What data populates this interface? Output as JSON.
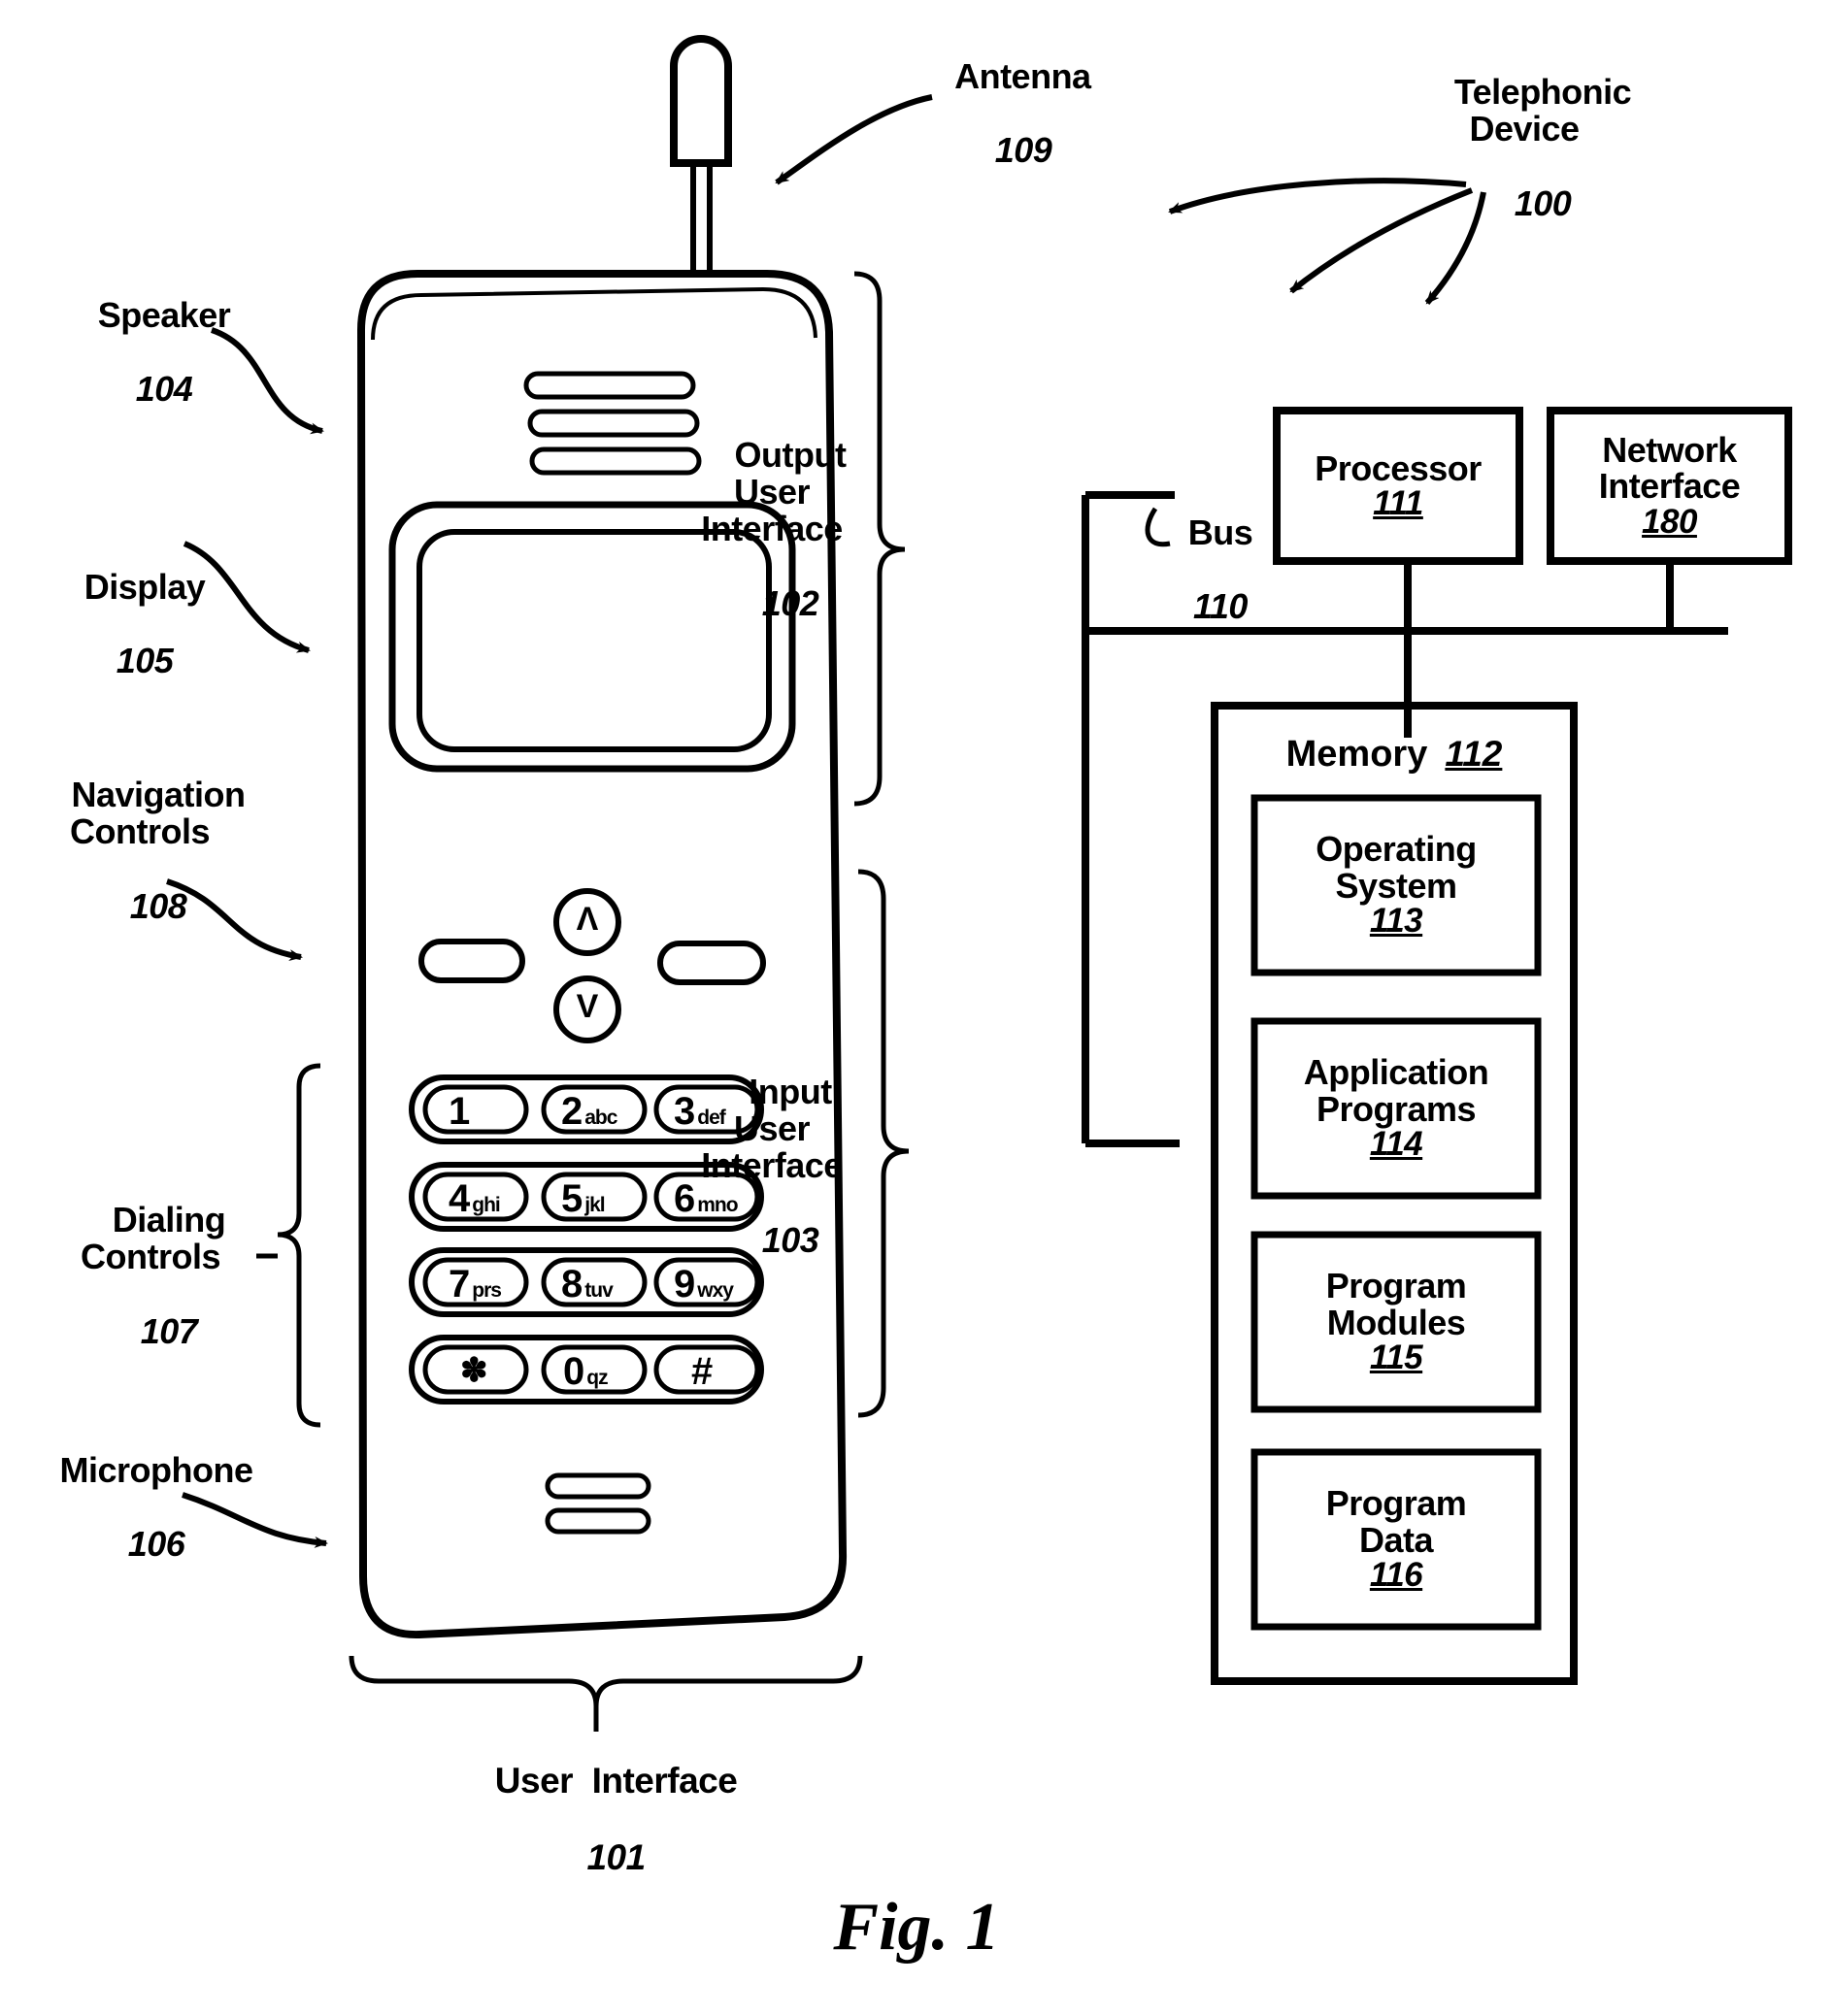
{
  "figure": {
    "caption": "Fig.   1"
  },
  "callouts": {
    "antenna": {
      "label": "Antenna",
      "ref": "109"
    },
    "telephonic_device": {
      "label": "Telephonic\nDevice",
      "ref": "100"
    },
    "speaker": {
      "label": "Speaker",
      "ref": "104"
    },
    "display": {
      "label": "Display",
      "ref": "105"
    },
    "navigation_controls": {
      "label": "Navigation\nControls",
      "ref": "108"
    },
    "dialing_controls": {
      "label": "Dialing\nControls",
      "ref": "107"
    },
    "microphone": {
      "label": "Microphone",
      "ref": "106"
    },
    "user_interface": {
      "label": "User  Interface",
      "ref": "101"
    },
    "output_user_interface": {
      "label": "Output\nUser\nInterface",
      "ref": "102"
    },
    "input_user_interface": {
      "label": "Input\nUser\nInterface",
      "ref": "103"
    },
    "bus": {
      "label": "Bus",
      "ref": "110"
    }
  },
  "blocks": {
    "processor": {
      "label": "Processor",
      "ref": "111"
    },
    "network_interface": {
      "label": "Network\nInterface",
      "ref": "180"
    },
    "memory": {
      "label": "Memory",
      "ref": "112"
    },
    "operating_system": {
      "label": "Operating\nSystem",
      "ref": "113"
    },
    "application_programs": {
      "label": "Application\nPrograms",
      "ref": "114"
    },
    "program_modules": {
      "label": "Program\nModules",
      "ref": "115"
    },
    "program_data": {
      "label": "Program\nData",
      "ref": "116"
    }
  },
  "keypad": {
    "keys": [
      {
        "digit": "1",
        "letters": ""
      },
      {
        "digit": "2",
        "letters": "abc"
      },
      {
        "digit": "3",
        "letters": "def"
      },
      {
        "digit": "4",
        "letters": "ghi"
      },
      {
        "digit": "5",
        "letters": "jkl"
      },
      {
        "digit": "6",
        "letters": "mno"
      },
      {
        "digit": "7",
        "letters": "prs"
      },
      {
        "digit": "8",
        "letters": "tuv"
      },
      {
        "digit": "9",
        "letters": "wxy"
      },
      {
        "digit": "✽",
        "letters": ""
      },
      {
        "digit": "0",
        "letters": "qz"
      },
      {
        "digit": "#",
        "letters": ""
      }
    ]
  },
  "navigation": {
    "up_glyph": "Λ",
    "down_glyph": "V"
  },
  "colors": {
    "ink": "#000000",
    "paper": "#ffffff"
  }
}
